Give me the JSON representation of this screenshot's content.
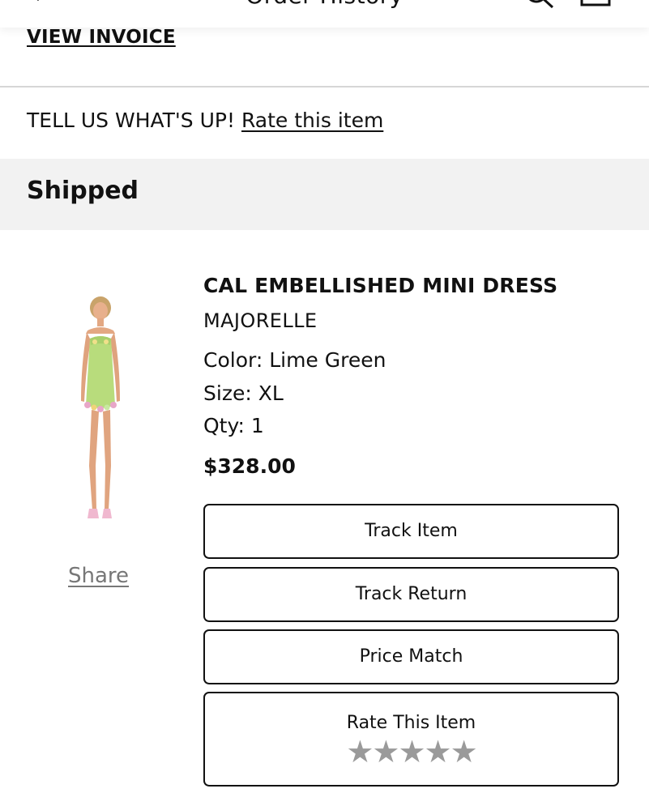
{
  "header": {
    "title": "Order History"
  },
  "invoice": {
    "label": "VIEW INVOICE"
  },
  "feedback": {
    "prompt": "TELL US WHAT'S UP!",
    "link": "Rate this item"
  },
  "status": {
    "label": "Shipped"
  },
  "product": {
    "name": "CAL EMBELLISHED MINI DRESS",
    "brand": "MAJORELLE",
    "color": "Color: Lime Green",
    "size": "Size: XL",
    "qty": "Qty: 1",
    "price": "$328.00",
    "share_label": "Share",
    "image_icon": "dress-product-photo"
  },
  "actions": {
    "track_item": "Track Item",
    "track_return": "Track Return",
    "price_match": "Price Match",
    "rate_item": "Rate This Item",
    "rating_stars": "★★★★★",
    "rating_value": 0,
    "rating_max": 5
  },
  "colors": {
    "band_background": "#f2f2f2",
    "star_gray": "#9a9a9a",
    "share_gray": "#777777",
    "dress_green": "#b8dc7c"
  }
}
